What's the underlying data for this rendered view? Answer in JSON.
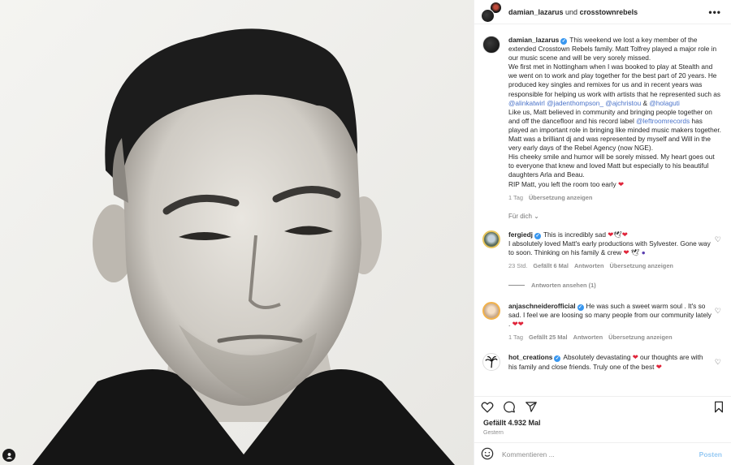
{
  "header": {
    "user1": "damian_lazarus",
    "joiner": " und ",
    "user2": "crosstownrebels",
    "more": "•••"
  },
  "caption": {
    "username": "damian_lazarus",
    "p1": "This weekend we lost a key member of the extended Crosstown Rebels family. Matt Tolfrey played a major role in our music scene and will be very sorely missed.",
    "p2a": "We first met in Nottingham when I was booked to play at Stealth and we went on to work and play together for the best part of 20 years. He produced key singles and remixes for us and in recent years was responsible for helping us work with artists that he represented such as ",
    "m1": "@alinkatwirl",
    "m2": "@jadenthompson_",
    "m3": "@ajchristou",
    "amp": " & ",
    "m4": "@holaguti",
    "p3a": "Like us, Matt believed in community and bringing people together on and off the dancefloor and his record label ",
    "m5": "@leftroomrecords",
    "p3b": " has played an important role in bringing like minded music makers together. Matt was a brilliant dj and was represented by myself and Will in the very early days of the Rebel Agency (now NGE).",
    "p4": "His cheeky smile and humor will be sorely missed. My heart goes out to everyone that knew and loved Matt but especially to his beautiful daughters Arla and Beau.",
    "p5": "RIP Matt, you left the room too early",
    "time": "1 Tag",
    "translate": "Übersetzung anzeigen"
  },
  "fuer_dich": "Für dich",
  "comments": [
    {
      "username": "fergiedj",
      "text1": "This is incredibly sad",
      "text2": "I absolutely loved Matt's early productions with Sylvester. Gone way to soon. Thinking on his family & crew",
      "time": "23 Std.",
      "likes": "Gefällt 6 Mal",
      "reply": "Antworten",
      "translate": "Übersetzung anzeigen",
      "view_replies": "Antworten ansehen (1)"
    },
    {
      "username": "anjaschneiderofficial",
      "text1": "He was such a sweet warm soul . It's so sad. I feel we are loosing so many people from our community lately .",
      "time": "1 Tag",
      "likes": "Gefällt 25 Mal",
      "reply": "Antworten",
      "translate": "Übersetzung anzeigen"
    },
    {
      "username": "hot_creations",
      "text1": "Absolutely devastating",
      "text2": "our thoughts are with his family and close friends. Truly one of the best"
    }
  ],
  "footer": {
    "likes": "Gefällt 4.932 Mal",
    "date": "Gestern",
    "comment_placeholder": "Kommentieren ...",
    "post": "Posten"
  },
  "colors": {
    "verified": "#3897f0",
    "mention": "#4a73c9",
    "heart": "#e0243a",
    "muted": "#8e8e8e",
    "post": "#95c9f3"
  }
}
